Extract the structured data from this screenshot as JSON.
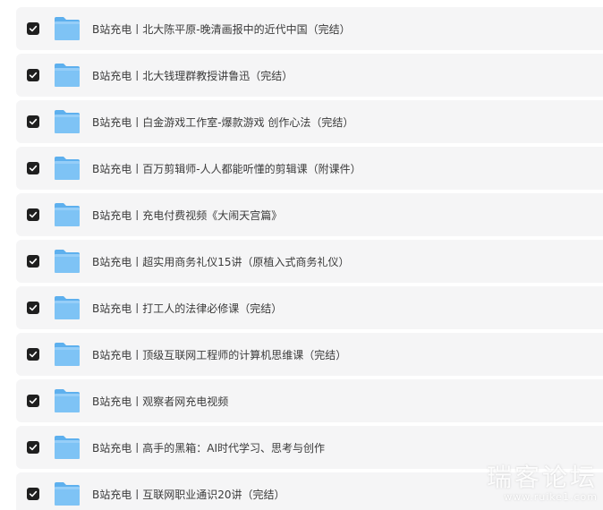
{
  "files": [
    {
      "name": "B站充电丨北大陈平原-晚清画报中的近代中国（完结）",
      "checked": true
    },
    {
      "name": "B站充电丨北大钱理群教授讲鲁迅（完结）",
      "checked": true
    },
    {
      "name": "B站充电丨白金游戏工作室-爆款游戏 创作心法（完结）",
      "checked": true
    },
    {
      "name": "B站充电丨百万剪辑师-人人都能听懂的剪辑课（附课件）",
      "checked": true
    },
    {
      "name": "B站充电丨充电付费视频《大闹天宫篇》",
      "checked": true
    },
    {
      "name": "B站充电丨超实用商务礼仪15讲（原植入式商务礼仪）",
      "checked": true
    },
    {
      "name": "B站充电丨打工人的法律必修课（完结）",
      "checked": true
    },
    {
      "name": "B站充电丨顶级互联网工程师的计算机思维课（完结）",
      "checked": true
    },
    {
      "name": "B站充电丨观察者网充电视频",
      "checked": true
    },
    {
      "name": "B站充电丨高手的黑箱：AI时代学习、思考与创作",
      "checked": true
    },
    {
      "name": "B站充电丨互联网职业通识20讲（完结）",
      "checked": true
    }
  ],
  "icons": {
    "checkbox": "check-icon",
    "folder": "folder-icon"
  },
  "colors": {
    "row_background": "#f5f5f6",
    "checkbox": "#1f1f1f",
    "folder_body": "#7ec3f5",
    "folder_back": "#5eb0ee"
  },
  "watermark": {
    "main": "瑞客论坛",
    "sub": "www.ruike1.com"
  }
}
